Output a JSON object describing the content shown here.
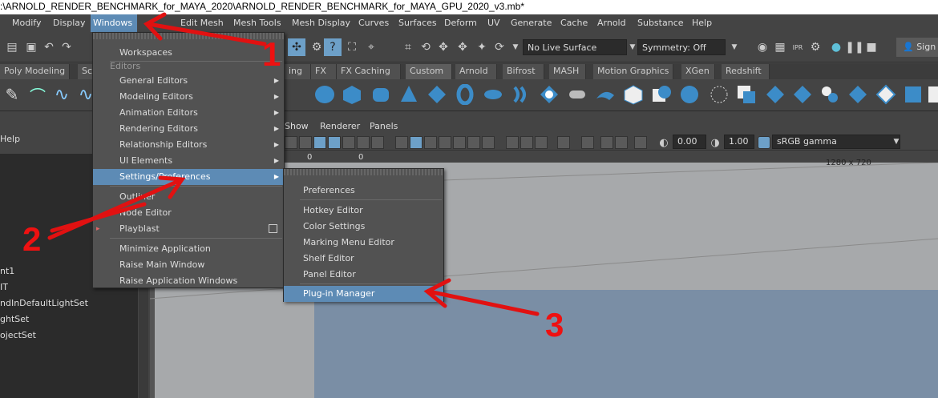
{
  "title_bar": {
    "text": ":\\ARNOLD_RENDER_BENCHMARK_for_MAYA_2020\\ARNOLD_RENDER_BENCHMARK_for_MAYA_GPU_2020_v3.mb*"
  },
  "menubar": {
    "items": [
      "Modify",
      "Display",
      "Windows",
      "Edit Mesh",
      "Mesh Tools",
      "Mesh Display",
      "Curves",
      "Surfaces",
      "Deform",
      "UV",
      "Generate",
      "Cache",
      "Arnold",
      "Substance",
      "Help"
    ],
    "active": "Windows"
  },
  "status_line": {
    "live_surface": "No Live Surface",
    "symmetry": "Symmetry: Off",
    "sign_in": "Sign"
  },
  "shelf_tabs": [
    "Poly Modeling",
    "Sc",
    "ing",
    "FX",
    "FX Caching",
    "Custom",
    "Arnold",
    "Bifrost",
    "MASH",
    "Motion Graphics",
    "XGen",
    "Redshift"
  ],
  "panel": {
    "help_label": "Help",
    "view_menu": [
      "Show",
      "Renderer",
      "Panels"
    ],
    "exposure": "0.00",
    "gamma": "1.00",
    "colorspace": "sRGB gamma",
    "hud_values": [
      "0",
      "0"
    ],
    "resolution": "1280 x 720"
  },
  "outliner": {
    "items": [
      "nt1",
      "IT",
      "ndInDefaultLightSet",
      "ghtSet",
      "ojectSet"
    ]
  },
  "windows_menu": {
    "workspaces": "Workspaces",
    "section_editors": "Editors",
    "items": [
      {
        "label": "General Editors",
        "submenu": true
      },
      {
        "label": "Modeling Editors",
        "submenu": true
      },
      {
        "label": "Animation Editors",
        "submenu": true
      },
      {
        "label": "Rendering Editors",
        "submenu": true
      },
      {
        "label": "Relationship Editors",
        "submenu": true
      },
      {
        "label": "UI Elements",
        "submenu": true
      },
      {
        "label": "Settings/Preferences",
        "submenu": true
      }
    ],
    "outliner": "Outliner",
    "node_editor": "Node Editor",
    "playblast": "Playblast",
    "minimize": "Minimize Application",
    "raise_main": "Raise Main Window",
    "raise_app": "Raise Application Windows"
  },
  "settings_submenu": {
    "preferences": "Preferences",
    "items": [
      "Hotkey Editor",
      "Color Settings",
      "Marking Menu Editor",
      "Shelf Editor",
      "Panel Editor"
    ],
    "plugin_manager": "Plug-in Manager"
  },
  "annotations": [
    "1",
    "2",
    "3"
  ],
  "colors": {
    "highlight": "#5d8bb5",
    "annotation": "#e11111",
    "menu_bg": "#525252",
    "ui_bg": "#444444"
  }
}
